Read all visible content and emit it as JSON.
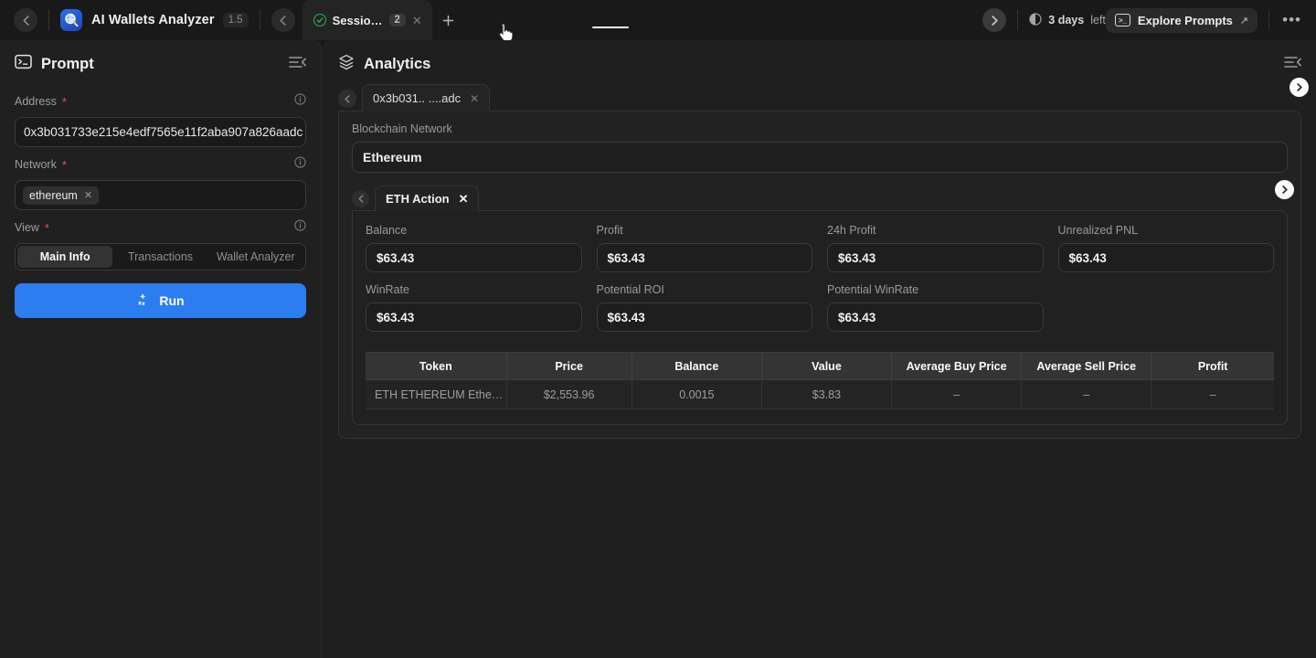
{
  "topbar": {
    "back_icon": "chevron-left-icon",
    "app_icon": "app-logo-icon",
    "app_title": "AI Wallets Analyzer",
    "version": "1.5",
    "tab_back_icon": "chevron-left-icon",
    "session": {
      "status_icon": "check-circle-icon",
      "label": "Sessio…",
      "count": "2",
      "close_icon": "close-icon"
    },
    "new_tab_icon": "plus-icon",
    "forward_icon": "chevron-right-icon",
    "timer_icon": "clock-icon",
    "days_value": "3 days",
    "days_suffix": "left",
    "explore": {
      "icon": "terminal-icon",
      "label": "Explore Prompts",
      "external_icon": "external-link-icon"
    },
    "more_icon": "more-horizontal-icon"
  },
  "prompt_panel": {
    "icon": "terminal-icon",
    "title": "Prompt",
    "collapse_icon": "collapse-panel-icon",
    "fields": {
      "address": {
        "label": "Address",
        "required": "*",
        "info_icon": "info-icon",
        "value": "0x3b031733e215e4edf7565e11f2aba907a826aadc"
      },
      "network": {
        "label": "Network",
        "required": "*",
        "info_icon": "info-icon",
        "tag": "ethereum",
        "tag_remove_icon": "close-icon"
      },
      "view": {
        "label": "View",
        "required": "*",
        "info_icon": "info-icon",
        "options": [
          "Main Info",
          "Transactions",
          "Wallet Analyzer"
        ],
        "selected": "Main Info"
      }
    },
    "run_button": {
      "icon": "sparkle-icon",
      "label": "Run"
    }
  },
  "analytics": {
    "icon": "layers-icon",
    "title": "Analytics",
    "collapse_icon": "collapse-panel-icon",
    "nav_prev_icon": "chevron-left-icon",
    "nav_next_icon": "chevron-right-icon",
    "tabs_l1": [
      {
        "label": "0x3b031.. ....adc",
        "close_icon": "close-icon"
      }
    ],
    "blockchain_network": {
      "label": "Blockchain Network",
      "value": "Ethereum"
    },
    "tabs_l2": [
      {
        "label": "ETH Action",
        "close_icon": "close-icon"
      }
    ],
    "metrics": [
      {
        "label": "Balance",
        "value": "$63.43"
      },
      {
        "label": "Profit",
        "value": "$63.43"
      },
      {
        "label": "24h Profit",
        "value": "$63.43"
      },
      {
        "label": "Unrealized PNL",
        "value": "$63.43"
      },
      {
        "label": "WinRate",
        "value": "$63.43"
      },
      {
        "label": "Potential ROI",
        "value": "$63.43"
      },
      {
        "label": "Potential WinRate",
        "value": "$63.43"
      }
    ],
    "table": {
      "columns": [
        "Token",
        "Price",
        "Balance",
        "Value",
        "Average Buy Price",
        "Average Sell Price",
        "Profit"
      ],
      "rows": [
        [
          "ETH ETHEREUM Ethe…",
          "$2,553.96",
          "0.0015",
          "$3.83",
          "–",
          "–",
          "–"
        ]
      ]
    }
  },
  "colors": {
    "accent_blue": "#2c7ef0",
    "status_green": "#2bb24c",
    "required_red": "#e2564d",
    "panel_bg": "#202020",
    "page_bg": "#191919"
  }
}
